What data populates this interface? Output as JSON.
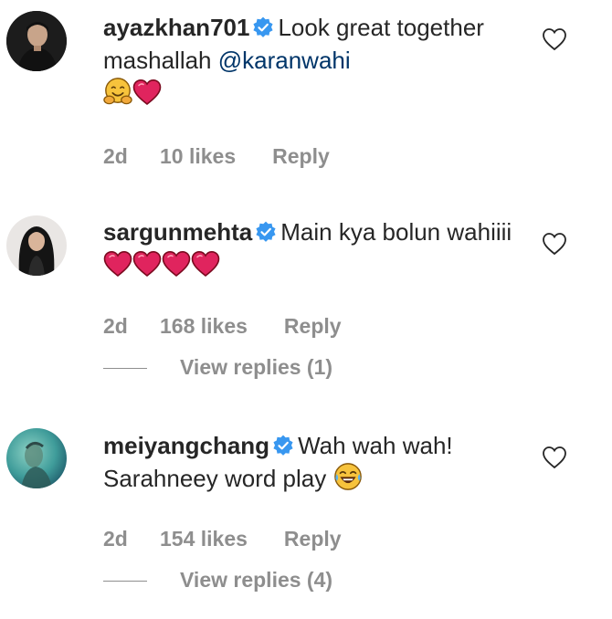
{
  "comments": [
    {
      "username": "ayazkhan701",
      "text": "Look great together mashallah",
      "mention": "@karanwahi",
      "emojis": [
        "hugging-face",
        "red-heart"
      ],
      "time": "2d",
      "likes": "10 likes",
      "reply": "Reply",
      "view_replies": ""
    },
    {
      "username": "sargunmehta",
      "text": "Main kya bolun wahiiii",
      "emojis": [
        "red-heart",
        "red-heart",
        "red-heart",
        "red-heart"
      ],
      "time": "2d",
      "likes": "168 likes",
      "reply": "Reply",
      "view_replies": "View replies (1)"
    },
    {
      "username": "meiyangchang",
      "text": "Wah wah wah! Sarahneey word play",
      "emojis": [
        "tears-of-joy"
      ],
      "time": "2d",
      "likes": "154 likes",
      "reply": "Reply",
      "view_replies": "View replies (4)"
    }
  ],
  "colors": {
    "verified_blue": "#3897f0",
    "heart_red": "#e0245e",
    "meta_grey": "#8e8e8e",
    "mention_blue": "#003569"
  }
}
